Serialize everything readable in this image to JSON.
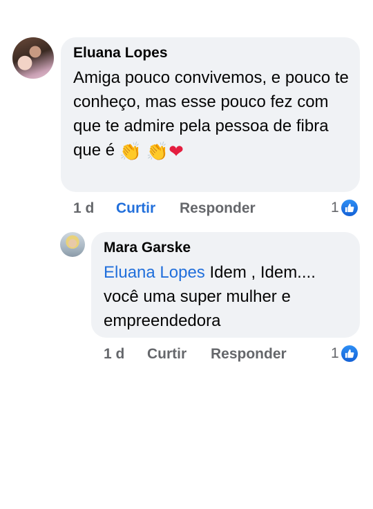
{
  "comments": [
    {
      "author": "Eluana Lopes",
      "text": "Amiga pouco convivemos, e pouco te conheço, mas esse pouco fez com que te admire pela pessoa de fibra que é",
      "emojis": [
        "👏",
        "👏",
        "❤"
      ],
      "time": "1 d",
      "like_label": "Curtir",
      "reply_label": "Responder",
      "reaction_count": "1"
    },
    {
      "author": "Mara Garske",
      "mention": "Eluana Lopes",
      "text": "Idem , Idem.... você uma super mulher e empreendedora",
      "time": "1 d",
      "like_label": "Curtir",
      "reply_label": "Responder",
      "reaction_count": "1"
    }
  ],
  "colors": {
    "bubble": "#f0f2f5",
    "link": "#216fdb",
    "meta": "#65676b",
    "like_badge": "#1877f2"
  },
  "icons": {
    "reaction": "like-thumb-icon"
  }
}
